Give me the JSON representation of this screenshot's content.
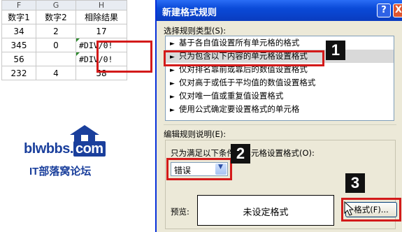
{
  "spreadsheet": {
    "columns": [
      "F",
      "G",
      "H"
    ],
    "header": [
      "数字1",
      "数字2",
      "相除结果"
    ],
    "rows": [
      [
        "34",
        "2",
        "17"
      ],
      [
        "345",
        "0",
        "#DIV/0!"
      ],
      [
        "56",
        "",
        "#DIV/0!"
      ],
      [
        "232",
        "4",
        "58"
      ]
    ]
  },
  "logo": {
    "brand": "blwbbs.",
    "brand_suffix": "com",
    "subtitle": "IT部落窝论坛"
  },
  "dialog": {
    "title": "新建格式规则",
    "help_label": "?",
    "close_label": "X",
    "rule_type_label": "选择规则类型(S):",
    "rule_types": [
      "基于各自值设置所有单元格的格式",
      "只为包含以下内容的单元格设置格式",
      "仅对排名靠前或靠后的数值设置格式",
      "仅对高于或低于平均值的数值设置格式",
      "仅对唯一值或重复值设置格式",
      "使用公式确定要设置格式的单元格"
    ],
    "selected_rule_index": 1,
    "edit_desc_label": "编辑规则说明(E):",
    "condition_label": "只为满足以下条件的单元格设置格式(O):",
    "condition_value": "错误",
    "preview_label": "预览:",
    "preview_text": "未设定格式",
    "format_button": "格式(F)..."
  },
  "callouts": [
    "1",
    "2",
    "3"
  ],
  "colors": {
    "highlight": "#d31a1a",
    "titlebar": "#0a4ad8",
    "brand": "#1a3f9c",
    "dialog_bg": "#ece9d8"
  }
}
